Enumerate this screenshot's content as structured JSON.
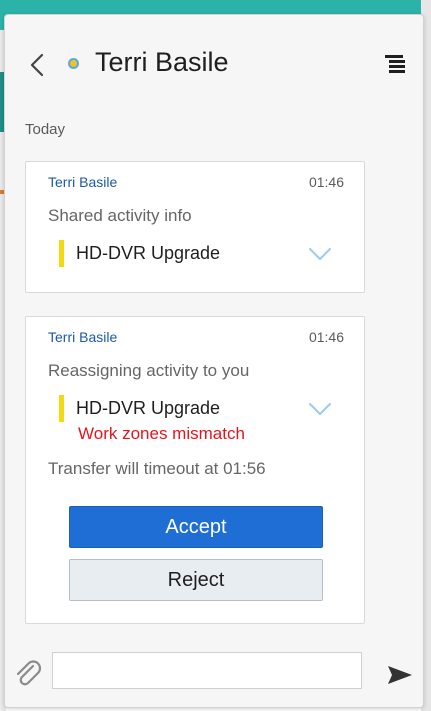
{
  "header": {
    "title": "Terri Basile",
    "status_color": "#f3c21b"
  },
  "conversation": {
    "date_label": "Today",
    "messages": [
      {
        "sender": "Terri Basile",
        "time": "01:46",
        "text": "Shared activity info",
        "activity": "HD-DVR Upgrade"
      },
      {
        "sender": "Terri Basile",
        "time": "01:46",
        "text": "Reassigning activity to you",
        "activity": "HD-DVR Upgrade",
        "warning": "Work zones mismatch",
        "timeout_text": "Transfer will timeout at 01:56",
        "accept_label": "Accept",
        "reject_label": "Reject"
      }
    ]
  },
  "composer": {
    "value": "",
    "placeholder": ""
  },
  "icons": {
    "back": "chevron-left-icon",
    "menu": "menu-icon",
    "expand": "chevron-down-icon",
    "attach": "paperclip-icon",
    "send": "send-icon"
  },
  "colors": {
    "accent": "#1f6ed5",
    "warning": "#e8141b",
    "activity_marker": "#f5d90f",
    "sender_link": "#1b5aa6"
  }
}
